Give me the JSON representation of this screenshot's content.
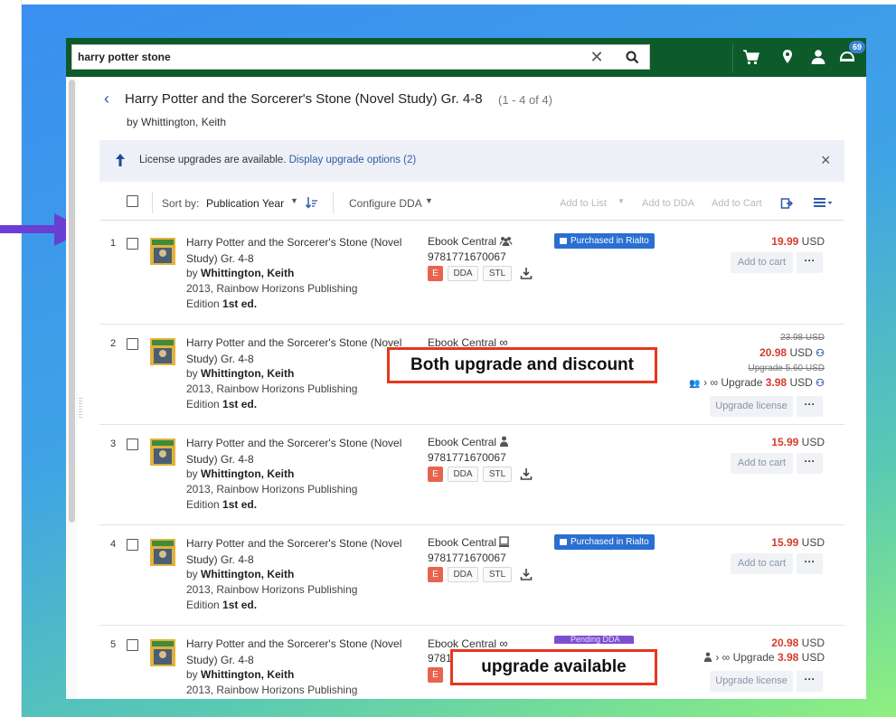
{
  "search": {
    "value": "harry potter stone"
  },
  "header": {
    "notification_count": "69"
  },
  "work": {
    "title": "Harry Potter and the Sorcerer's Stone (Novel Study) Gr. 4-8",
    "count": "(1 - 4 of 4)",
    "by_prefix": "by ",
    "author": "Whittington, Keith"
  },
  "notice": {
    "text": "License upgrades are available.",
    "link": "Display upgrade options (2)"
  },
  "toolbar": {
    "sort_label": "Sort by:",
    "sort_value": "Publication Year",
    "configure": "Configure DDA",
    "add_to_list": "Add to List",
    "add_to_dda": "Add to DDA",
    "add_to_cart": "Add to Cart"
  },
  "rows": [
    {
      "num": "1",
      "title": "Harry Potter and the Sorcerer's Stone (Novel Study) Gr. 4-8",
      "author": "Whittington, Keith",
      "pub": "2013, Rainbow Horizons Publishing",
      "edition_label": "Edition",
      "edition": "1st ed.",
      "platform": "Ebook Central",
      "isbn": "9781771670067",
      "tag_e": "E",
      "tag_dda": "DDA",
      "tag_stl": "STL",
      "status": "Purchased in Rialto",
      "price": "19.99",
      "currency": "USD",
      "btn": "Add to cart"
    },
    {
      "num": "2",
      "title": "Harry Potter and the Sorcerer's Stone (Novel Study) Gr. 4-8",
      "author": "Whittington, Keith",
      "pub": "2013, Rainbow Horizons Publishing",
      "edition_label": "Edition",
      "edition": "1st ed.",
      "platform": "Ebook Central",
      "old_price": "23.98 USD",
      "price": "20.98",
      "currency": "USD",
      "old_upgrade": "Upgrade 5.60 USD",
      "upgrade_label": "Upgrade",
      "upgrade_price": "3.98",
      "btn": "Upgrade license"
    },
    {
      "num": "3",
      "title": "Harry Potter and the Sorcerer's Stone (Novel Study) Gr. 4-8",
      "author": "Whittington, Keith",
      "pub": "2013, Rainbow Horizons Publishing",
      "edition_label": "Edition",
      "edition": "1st ed.",
      "platform": "Ebook Central",
      "isbn": "9781771670067",
      "tag_e": "E",
      "tag_dda": "DDA",
      "tag_stl": "STL",
      "price": "15.99",
      "currency": "USD",
      "btn": "Add to cart"
    },
    {
      "num": "4",
      "title": "Harry Potter and the Sorcerer's Stone (Novel Study) Gr. 4-8",
      "author": "Whittington, Keith",
      "pub": "2013, Rainbow Horizons Publishing",
      "edition_label": "Edition",
      "edition": "1st ed.",
      "platform": "Ebook Central",
      "isbn": "9781771670067",
      "tag_e": "E",
      "tag_dda": "DDA",
      "tag_stl": "STL",
      "status": "Purchased in Rialto",
      "price": "15.99",
      "currency": "USD",
      "btn": "Add to cart"
    },
    {
      "num": "5",
      "title": "Harry Potter and the Sorcerer's Stone (Novel Study) Gr. 4-8",
      "author": "Whittington, Keith",
      "pub": "2013, Rainbow Horizons Publishing",
      "platform": "Ebook Central",
      "isbn_partial": "9781",
      "tag_e": "E",
      "status": "Pending DDA",
      "price": "20.98",
      "currency": "USD",
      "upgrade_label": "Upgrade",
      "upgrade_price": "3.98",
      "btn": "Upgrade license"
    }
  ],
  "callouts": {
    "both": "Both upgrade and discount",
    "upgrade": "upgrade available"
  },
  "colors": {
    "header": "#0d5a2a",
    "accent": "#2f5aa8",
    "price": "#d63b2a",
    "callout_border": "#e6371f",
    "arrow": "#6a3fd3"
  }
}
